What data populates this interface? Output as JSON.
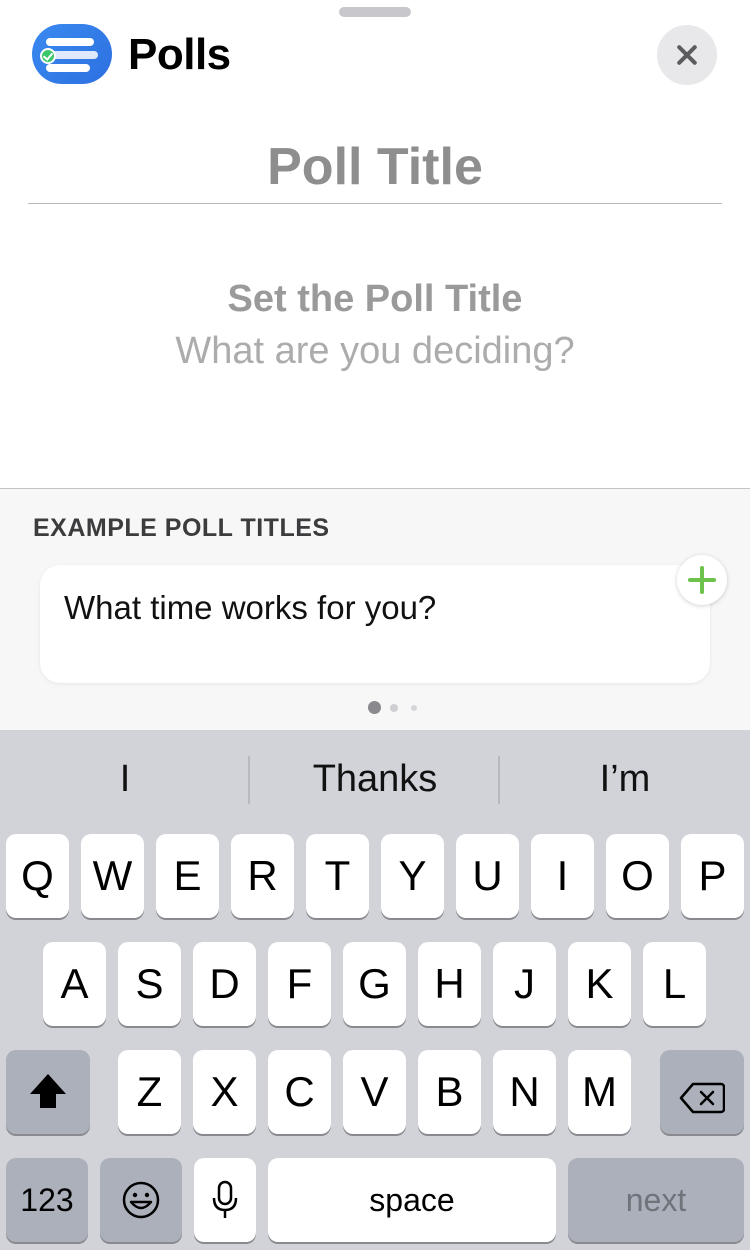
{
  "app": {
    "name": "Polls",
    "icon": "poll-list-icon"
  },
  "title_input": {
    "placeholder": "Poll Title",
    "value": ""
  },
  "prompt": {
    "title": "Set the Poll Title",
    "subtitle": "What are you deciding?"
  },
  "examples": {
    "heading": "EXAMPLE POLL TITLES",
    "cards": [
      {
        "text": "What time works for you?"
      }
    ],
    "page_count": 3,
    "current_page": 1
  },
  "keyboard": {
    "suggestions": [
      "I",
      "Thanks",
      "I’m"
    ],
    "row1": [
      "Q",
      "W",
      "E",
      "R",
      "T",
      "Y",
      "U",
      "I",
      "O",
      "P"
    ],
    "row2": [
      "A",
      "S",
      "D",
      "F",
      "G",
      "H",
      "J",
      "K",
      "L"
    ],
    "row3": [
      "Z",
      "X",
      "C",
      "V",
      "B",
      "N",
      "M"
    ],
    "numbers_label": "123",
    "space_label": "space",
    "return_label": "next"
  },
  "colors": {
    "accent_green": "#6cc24a",
    "app_blue": "#2d6fe0",
    "keyboard_bg": "#d1d3d9"
  }
}
